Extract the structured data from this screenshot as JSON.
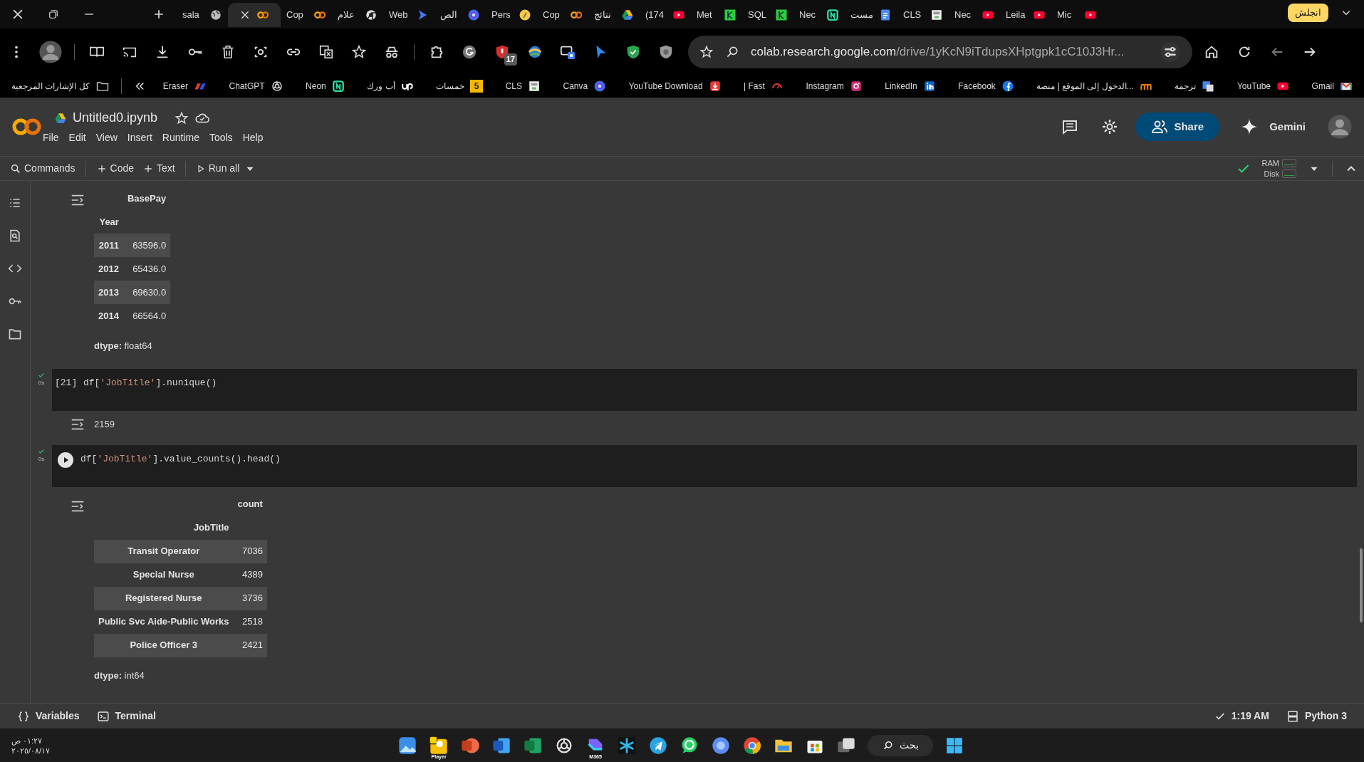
{
  "browser": {
    "tabs": [
      {
        "label": "sala",
        "selected": false
      },
      {
        "selected": true
      },
      {
        "label": "Cop",
        "selected": false
      },
      {
        "label": "علام",
        "selected": false
      },
      {
        "label": "Web",
        "selected": false
      },
      {
        "label": "الص",
        "selected": false
      },
      {
        "label": "Pers",
        "selected": false
      },
      {
        "label": "Cop",
        "selected": false
      },
      {
        "label": "نتائج",
        "selected": false
      },
      {
        "label": "(174",
        "selected": false
      },
      {
        "label": "Met",
        "selected": false
      },
      {
        "label": "SQL",
        "selected": false
      },
      {
        "label": "Nec",
        "selected": false
      },
      {
        "label": "مست",
        "selected": false
      },
      {
        "label": "CLS",
        "selected": false
      },
      {
        "label": "Nec",
        "selected": false
      },
      {
        "label": "Leila",
        "selected": false
      },
      {
        "label": "Mic",
        "selected": false
      }
    ],
    "profile_chip": "انجلش",
    "extension_badge": "17",
    "address": {
      "host": "colab.research.google.com",
      "path": "/drive/1yKcN9iTdupsXHptgpk1cC10J3Hr..."
    },
    "bookmarks_folder": "كل الإشارات المرجعية",
    "bookmarks": [
      {
        "label": "Eraser"
      },
      {
        "label": "ChatGPT"
      },
      {
        "label": "Neon"
      },
      {
        "label": "أب ورك"
      },
      {
        "label": "خمسات",
        "badge": "5"
      },
      {
        "label": "CLS"
      },
      {
        "label": "Canva"
      },
      {
        "label": "YouTube Download"
      },
      {
        "label": "| Fast"
      },
      {
        "label": "Instagram"
      },
      {
        "label": "LinkedIn"
      },
      {
        "label": "Facebook"
      },
      {
        "label": "الدخول إلى الموقع | منصة..."
      },
      {
        "label": "ترجمة"
      },
      {
        "label": "YouTube"
      },
      {
        "label": "Gmail"
      }
    ]
  },
  "notebook": {
    "title": "Untitled0.ipynb",
    "menu": [
      "File",
      "Edit",
      "View",
      "Insert",
      "Runtime",
      "Tools",
      "Help"
    ],
    "share": "Share",
    "gemini": "Gemini",
    "toolbar": {
      "commands": "Commands",
      "code": "Code",
      "text": "Text",
      "run_all": "Run all"
    },
    "resources": {
      "ram": "RAM",
      "disk": "Disk"
    }
  },
  "cells": [
    {
      "kind": "output",
      "output": {
        "kind": "table",
        "column": "BasePay",
        "index_name": "Year",
        "rows": [
          {
            "index": "2011",
            "value": "63596.0"
          },
          {
            "index": "2012",
            "value": "65436.0"
          },
          {
            "index": "2013",
            "value": "69630.0"
          },
          {
            "index": "2014",
            "value": "66564.0"
          }
        ],
        "dtype": "**dtype:** float64"
      }
    },
    {
      "kind": "code",
      "exec_count": "[21]",
      "run_status": "0s",
      "hovered": false,
      "code": [
        {
          "text": "df[",
          "kind": "plain"
        },
        {
          "text": "'JobTitle'",
          "kind": "string"
        },
        {
          "text": "].nunique()",
          "kind": "plain"
        }
      ],
      "output": {
        "kind": "text",
        "text": "2159"
      }
    },
    {
      "kind": "code",
      "run_status": "0s",
      "hovered": true,
      "code": [
        {
          "text": "df[",
          "kind": "plain"
        },
        {
          "text": "'JobTitle'",
          "kind": "string"
        },
        {
          "text": "].value_counts().head()",
          "kind": "plain"
        }
      ],
      "output": {
        "kind": "table",
        "column": "count",
        "index_name": "JobTitle",
        "rows": [
          {
            "index": "Transit Operator",
            "value": "7036"
          },
          {
            "index": "Special Nurse",
            "value": "4389"
          },
          {
            "index": "Registered Nurse",
            "value": "3736"
          },
          {
            "index": "Public Svc Aide-Public Works",
            "value": "2518"
          },
          {
            "index": "Police Officer 3",
            "value": "2421"
          }
        ],
        "dtype": "**dtype:** int64"
      }
    }
  ],
  "status_bar": {
    "variables": "Variables",
    "terminal": "Terminal",
    "time": "1:19 AM",
    "runtime": "Python 3"
  },
  "taskbar": {
    "time": "٠١:٢٧ ص",
    "date": "٢٠٢٥/٠٨/١٧",
    "player_label": "Player",
    "m365_label": "M365",
    "search": "بحث"
  }
}
